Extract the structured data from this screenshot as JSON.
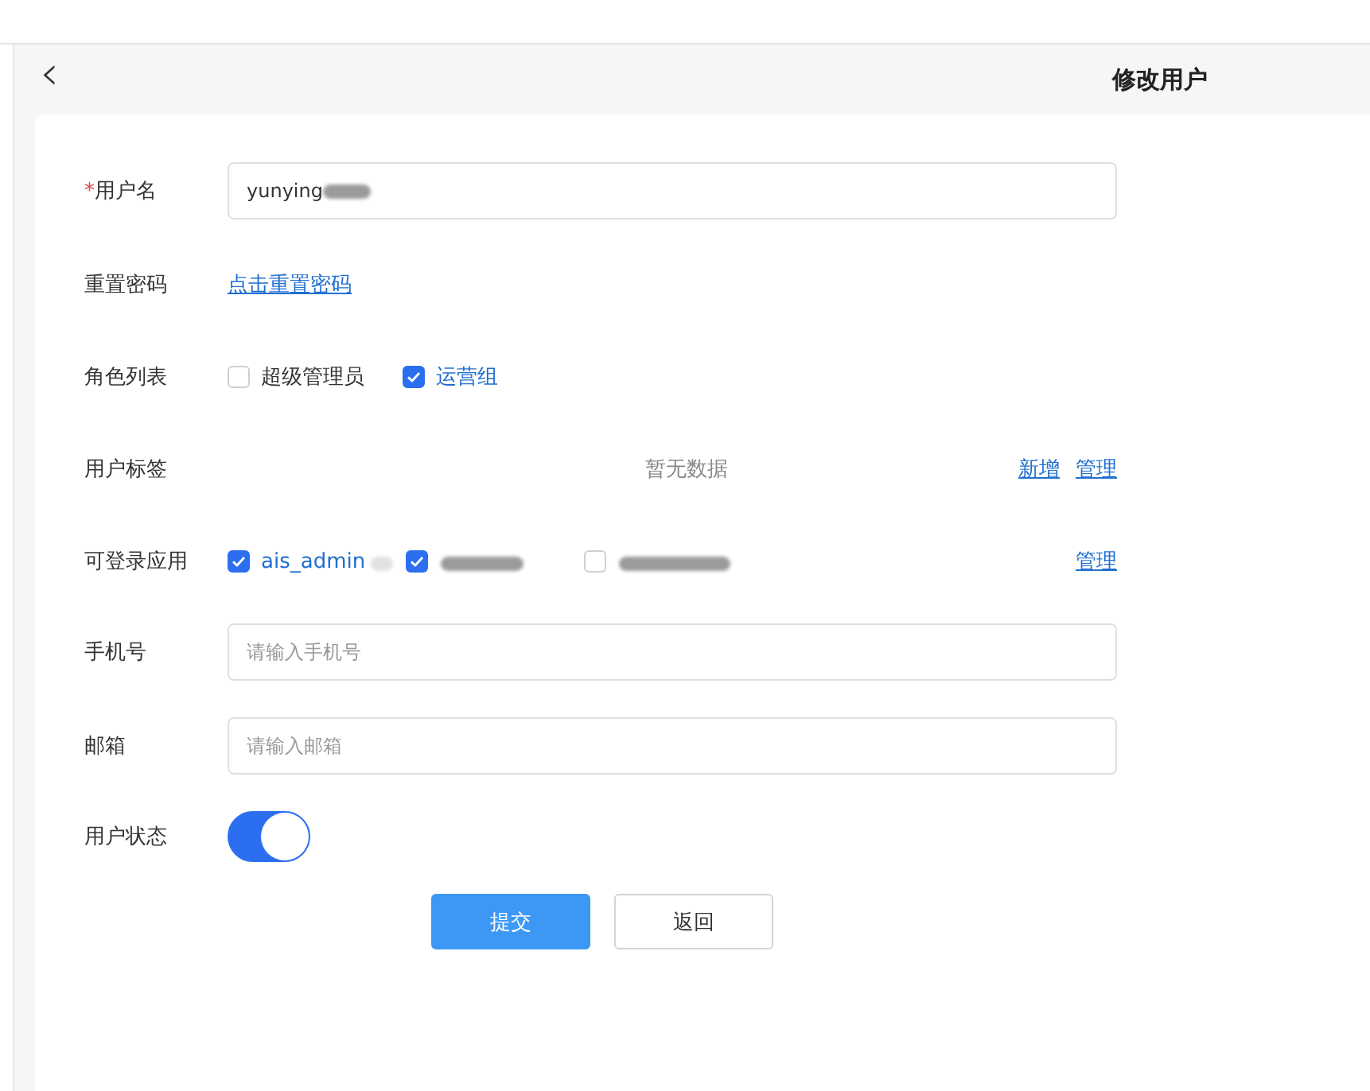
{
  "header": {
    "back": "‹",
    "title": "修改用户"
  },
  "form": {
    "username": {
      "label": "用户名",
      "required_mark": "*",
      "value": "yunying",
      "redacted": true
    },
    "reset_password": {
      "label": "重置密码",
      "link": "点击重置密码"
    },
    "roles": {
      "label": "角色列表",
      "options": [
        {
          "label": "超级管理员",
          "checked": false
        },
        {
          "label": "运营组",
          "checked": true
        }
      ]
    },
    "tags": {
      "label": "用户标签",
      "empty": "暂无数据",
      "actions": [
        "新增",
        "管理"
      ]
    },
    "apps": {
      "label": "可登录应用",
      "options": [
        {
          "label": "ais_admin",
          "checked": true,
          "redacted": true
        },
        {
          "checked": true,
          "redacted": true
        },
        {
          "checked": false,
          "redacted": true
        }
      ],
      "actions": [
        "管理"
      ]
    },
    "phone": {
      "label": "手机号",
      "placeholder": "请输入手机号"
    },
    "email": {
      "label": "邮箱",
      "placeholder": "请输入邮箱"
    },
    "status": {
      "label": "用户状态",
      "on": true
    }
  },
  "buttons": [
    {
      "label": "提交",
      "kind": "primary"
    },
    {
      "label": "返回",
      "kind": "default"
    }
  ]
}
